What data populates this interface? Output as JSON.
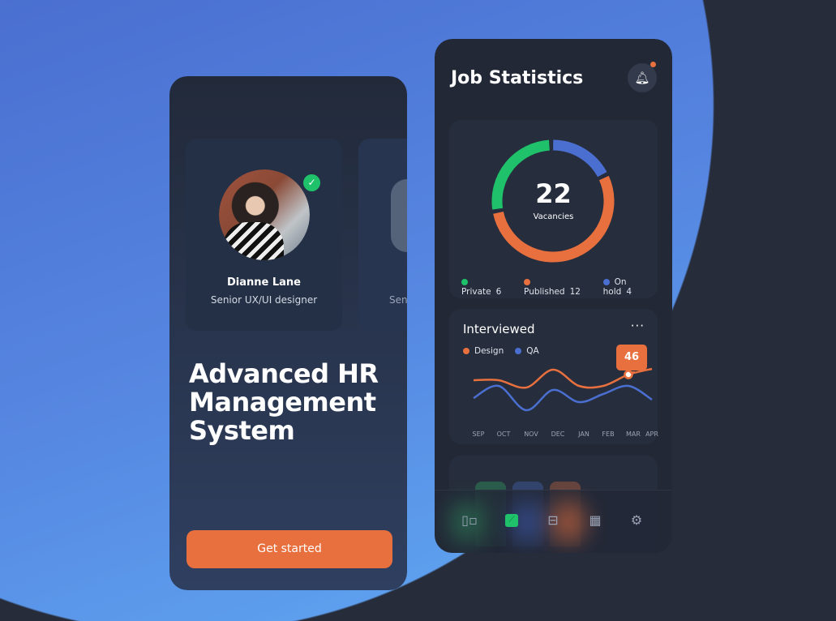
{
  "onboarding": {
    "profile": {
      "name": "Dianne Lane",
      "role": "Senior UX/UI designer",
      "verified": true
    },
    "next_profile_role_partial": "Sen",
    "headline": "Advanced HR Management System",
    "cta_label": "Get started"
  },
  "stats": {
    "title": "Job Statistics",
    "notification_badge": true,
    "donut": {
      "total": "22",
      "total_label": "Vacancies",
      "segments": [
        {
          "label": "Private",
          "value": "6",
          "color": "#1fc26b"
        },
        {
          "label": "Published",
          "value": "12",
          "color": "#e8703f"
        },
        {
          "label": "On hold",
          "value": "4",
          "color": "#4a6fd0"
        }
      ]
    },
    "interviewed": {
      "title": "Interviewed",
      "more_label": "···",
      "tooltip_value": "46",
      "months": [
        "SEP",
        "OCT",
        "NOV",
        "DEC",
        "JAN",
        "FEB",
        "MAR",
        "APR"
      ],
      "series": [
        {
          "name": "Design",
          "color": "#e8703f",
          "values": [
            42.5,
            42.5,
            38,
            49,
            39,
            39,
            46,
            49.5
          ]
        },
        {
          "name": "QA",
          "color": "#4a6fd0",
          "values": [
            31.5,
            39,
            24,
            36.5,
            29,
            34,
            39,
            30.5
          ]
        }
      ]
    },
    "nav": [
      "dashboard-icon",
      "chart-icon",
      "inbox-icon",
      "calendar-icon",
      "settings-icon"
    ],
    "nav_active": 1
  }
}
